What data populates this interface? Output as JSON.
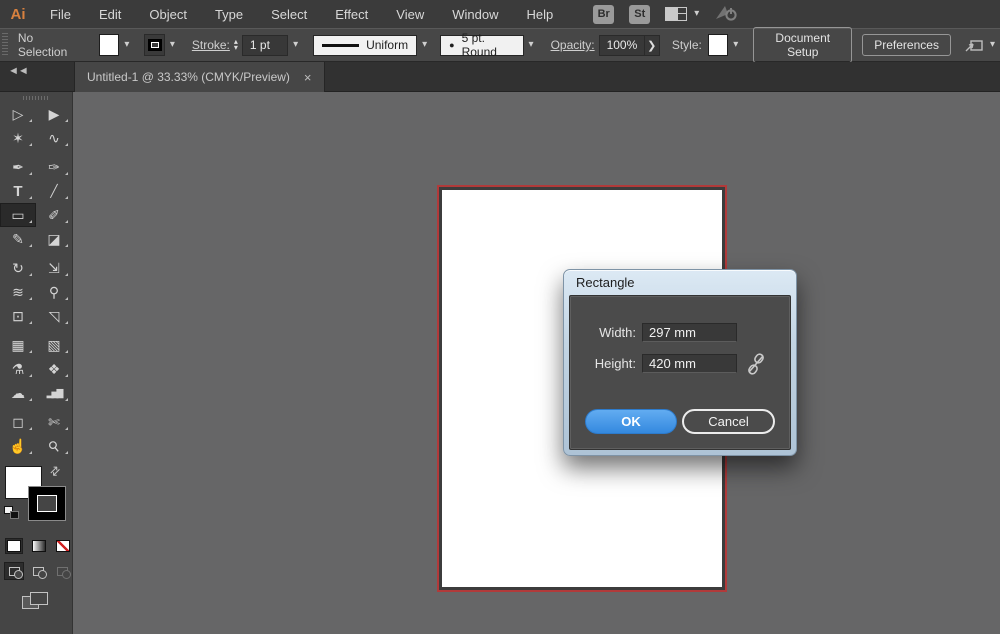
{
  "menubar": {
    "logo": "Ai",
    "items": [
      "File",
      "Edit",
      "Object",
      "Type",
      "Select",
      "Effect",
      "View",
      "Window",
      "Help"
    ],
    "bridge_button": "Br",
    "stock_button": "St"
  },
  "controlbar": {
    "selection_status": "No Selection",
    "stroke_label": "Stroke:",
    "stroke_width": "1 pt",
    "variable_width_profile": "Uniform",
    "brush_bullet": "●",
    "brush_definition": "5 pt. Round",
    "opacity_label": "Opacity:",
    "opacity_value": "100%",
    "style_label": "Style:",
    "document_setup_button": "Document Setup",
    "preferences_button": "Preferences"
  },
  "tabbar": {
    "tab_title": "Untitled-1 @ 33.33% (CMYK/Preview)"
  },
  "toolbar": {
    "group_breaks": [
      4,
      12,
      18,
      24
    ],
    "tools": [
      {
        "name": "selection-tool",
        "glyph": "▷",
        "selected": false
      },
      {
        "name": "direct-selection-tool",
        "glyph": "▶",
        "selected": false
      },
      {
        "name": "magic-wand-tool",
        "glyph": "✶",
        "selected": false
      },
      {
        "name": "lasso-tool",
        "glyph": "∿",
        "selected": false
      },
      {
        "name": "pen-tool",
        "glyph": "✒",
        "selected": false
      },
      {
        "name": "curvature-tool",
        "glyph": "✑",
        "selected": false
      },
      {
        "name": "type-tool",
        "glyph": "T",
        "selected": false
      },
      {
        "name": "line-segment-tool",
        "glyph": "╱",
        "selected": false
      },
      {
        "name": "rectangle-tool",
        "glyph": "▭",
        "selected": true
      },
      {
        "name": "paintbrush-tool",
        "glyph": "✐",
        "selected": false
      },
      {
        "name": "pencil-tool",
        "glyph": "✎",
        "selected": false
      },
      {
        "name": "eraser-tool",
        "glyph": "◪",
        "selected": false
      },
      {
        "name": "rotate-tool",
        "glyph": "↻",
        "selected": false
      },
      {
        "name": "scale-tool",
        "glyph": "⇲",
        "selected": false
      },
      {
        "name": "width-tool",
        "glyph": "≋",
        "selected": false
      },
      {
        "name": "puppet-warp-tool",
        "glyph": "⚲",
        "selected": false
      },
      {
        "name": "shape-builder-tool",
        "glyph": "⊡",
        "selected": false
      },
      {
        "name": "perspective-grid-tool",
        "glyph": "◹",
        "selected": false
      },
      {
        "name": "mesh-tool",
        "glyph": "▦",
        "selected": false
      },
      {
        "name": "gradient-tool",
        "glyph": "▧",
        "selected": false
      },
      {
        "name": "eyedropper-tool",
        "glyph": "⚗",
        "selected": false
      },
      {
        "name": "blend-tool",
        "glyph": "❖",
        "selected": false
      },
      {
        "name": "symbol-sprayer-tool",
        "glyph": "☁",
        "selected": false
      },
      {
        "name": "column-graph-tool",
        "glyph": "▂▅▇",
        "selected": false
      },
      {
        "name": "artboard-tool",
        "glyph": "◻",
        "selected": false
      },
      {
        "name": "slice-tool",
        "glyph": "✄",
        "selected": false
      },
      {
        "name": "hand-tool",
        "glyph": "☝",
        "selected": false
      },
      {
        "name": "zoom-tool",
        "glyph": "⚲",
        "selected": false
      }
    ]
  },
  "dialog": {
    "title": "Rectangle",
    "fields": [
      {
        "label": "Width:",
        "value": "297 mm"
      },
      {
        "label": "Height:",
        "value": "420 mm"
      }
    ],
    "ok_button": "OK",
    "cancel_button": "Cancel"
  },
  "icons": {
    "chevron_down": "▾",
    "stepper_up": "▴",
    "stepper_down": "▾",
    "arrow_right": "❯",
    "collapse": "◄◄",
    "close": "×",
    "swap": "⇄"
  },
  "colors": {
    "accent_blue": "#3f93e8",
    "artboard_outline_red": "#b13a3a",
    "canvas_gray": "#666667",
    "panel_gray": "#454545"
  }
}
